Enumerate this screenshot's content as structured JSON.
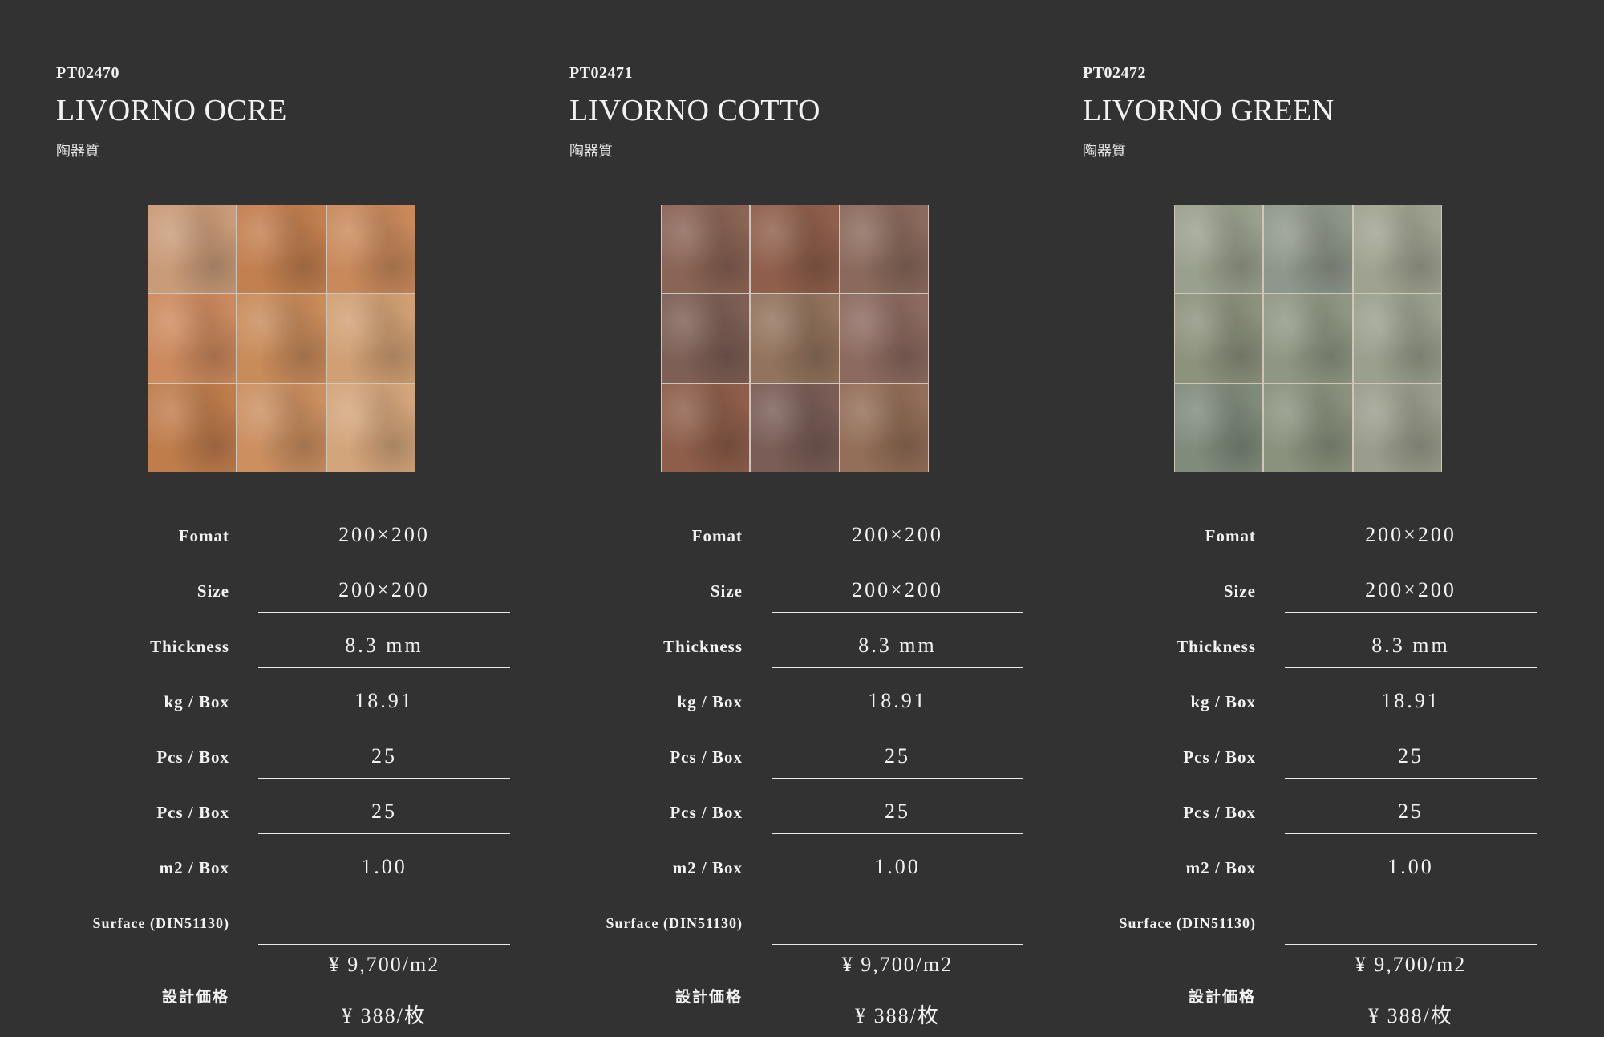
{
  "products": [
    {
      "code": "PT02470",
      "name": "LIVORNO OCRE",
      "material": "陶器質",
      "tile_colors": [
        "#c99b78",
        "#c27f4f",
        "#c9895b",
        "#cc8a5e",
        "#c88b5a",
        "#d0a074",
        "#bf7d4c",
        "#cb8f60",
        "#d3a57b"
      ],
      "specs": [
        {
          "label": "Fomat",
          "value": "200×200"
        },
        {
          "label": "Size",
          "value": "200×200"
        },
        {
          "label": "Thickness",
          "value": "8.3 mm"
        },
        {
          "label": "kg / Box",
          "value": "18.91"
        },
        {
          "label": "Pcs / Box",
          "value": "25"
        },
        {
          "label": "Pcs / Box",
          "value": "25"
        },
        {
          "label": "m2 / Box",
          "value": "1.00"
        },
        {
          "label": "Surface (DIN51130)",
          "value": ""
        }
      ],
      "price_label": "設計価格",
      "price_m2": "¥ 9,700/m2",
      "price_piece": "¥ 388/枚"
    },
    {
      "code": "PT02471",
      "name": "LIVORNO COTTO",
      "material": "陶器質",
      "tile_colors": [
        "#8a6455",
        "#8f5f4c",
        "#8a6a5c",
        "#7d5f55",
        "#92735d",
        "#8c6a60",
        "#8e5e4b",
        "#7a5d57",
        "#936e58"
      ],
      "specs": [
        {
          "label": "Fomat",
          "value": "200×200"
        },
        {
          "label": "Size",
          "value": "200×200"
        },
        {
          "label": "Thickness",
          "value": "8.3 mm"
        },
        {
          "label": "kg / Box",
          "value": "18.91"
        },
        {
          "label": "Pcs / Box",
          "value": "25"
        },
        {
          "label": "Pcs / Box",
          "value": "25"
        },
        {
          "label": "m2 / Box",
          "value": "1.00"
        },
        {
          "label": "Surface (DIN51130)",
          "value": ""
        }
      ],
      "price_label": "設計価格",
      "price_m2": "¥ 9,700/m2",
      "price_piece": "¥ 388/枚"
    },
    {
      "code": "PT02472",
      "name": "LIVORNO GREEN",
      "material": "陶器質",
      "tile_colors": [
        "#9aa08e",
        "#8f978a",
        "#a0a291",
        "#8d927d",
        "#8f9784",
        "#9a9f8e",
        "#7f8c7c",
        "#8a927e",
        "#9a9d8d"
      ],
      "specs": [
        {
          "label": "Fomat",
          "value": "200×200"
        },
        {
          "label": "Size",
          "value": "200×200"
        },
        {
          "label": "Thickness",
          "value": "8.3 mm"
        },
        {
          "label": "kg / Box",
          "value": "18.91"
        },
        {
          "label": "Pcs / Box",
          "value": "25"
        },
        {
          "label": "Pcs / Box",
          "value": "25"
        },
        {
          "label": "m2 / Box",
          "value": "1.00"
        },
        {
          "label": "Surface (DIN51130)",
          "value": ""
        }
      ],
      "price_label": "設計価格",
      "price_m2": "¥ 9,700/m2",
      "price_piece": "¥ 388/枚"
    }
  ]
}
